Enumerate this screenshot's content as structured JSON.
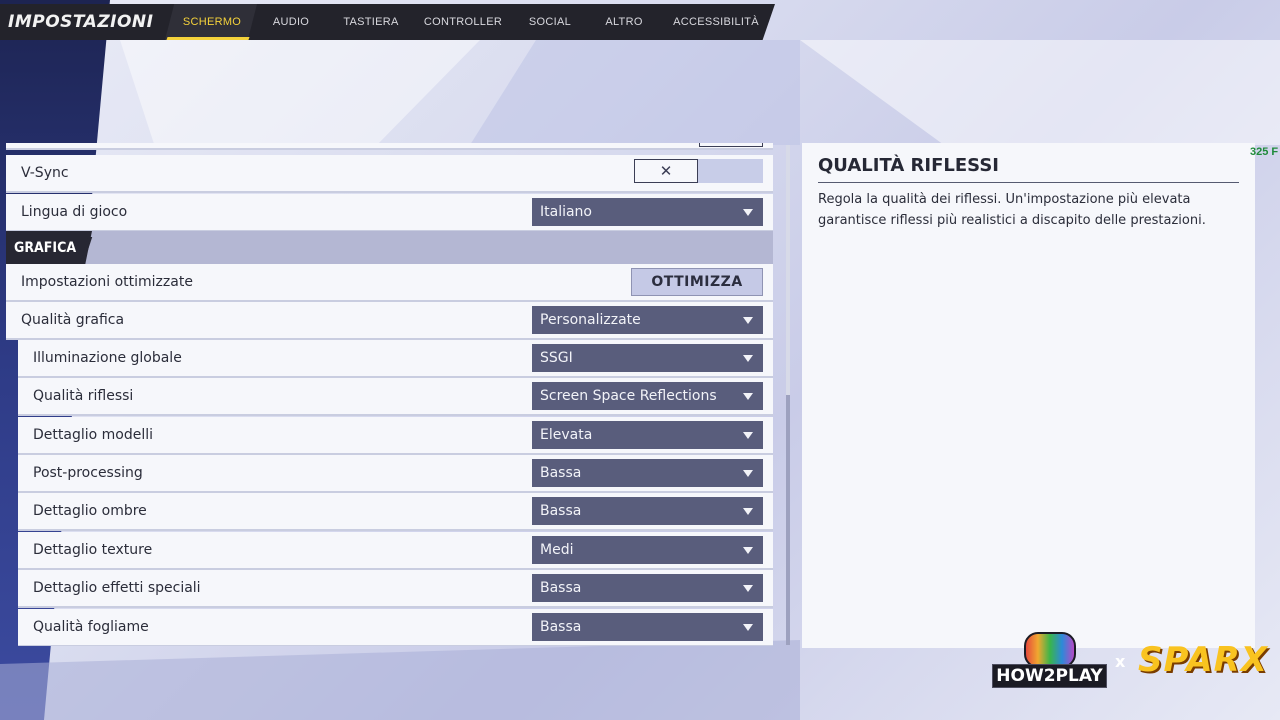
{
  "app_title": "IMPOSTAZIONI",
  "tabs": [
    {
      "label": "SCHERMO",
      "active": true
    },
    {
      "label": "AUDIO",
      "active": false
    },
    {
      "label": "TASTIERA",
      "active": false
    },
    {
      "label": "CONTROLLER",
      "active": false
    },
    {
      "label": "SOCIAL",
      "active": false
    },
    {
      "label": "ALTRO",
      "active": false
    },
    {
      "label": "ACCESSIBILITÀ",
      "active": false
    }
  ],
  "settings": {
    "vsync": {
      "label": "V-Sync",
      "icon": "close-icon",
      "value_symbol": "✕"
    },
    "language": {
      "label": "Lingua di gioco",
      "value": "Italiano"
    },
    "section_graphics": "GRAFICA",
    "optimized": {
      "label": "Impostazioni ottimizzate",
      "button": "OTTIMIZZA"
    },
    "quality": {
      "label": "Qualità grafica",
      "value": "Personalizzate"
    },
    "sub_items": [
      {
        "label": "Illuminazione globale",
        "value": "SSGI"
      },
      {
        "label": "Qualità riflessi",
        "value": "Screen Space Reflections"
      },
      {
        "label": "Dettaglio modelli",
        "value": "Elevata"
      },
      {
        "label": "Post-processing",
        "value": "Bassa"
      },
      {
        "label": "Dettaglio ombre",
        "value": "Bassa"
      },
      {
        "label": "Dettaglio texture",
        "value": "Medi"
      },
      {
        "label": "Dettaglio effetti speciali",
        "value": "Bassa"
      },
      {
        "label": "Qualità fogliame",
        "value": "Bassa"
      }
    ]
  },
  "description": {
    "title": "QUALITÀ RIFLESSI",
    "text": "Regola la qualità dei riflessi. Un'impostazione più elevata garantisce riflessi più realistici a discapito delle prestazioni."
  },
  "fps_counter": "325 F",
  "logos": {
    "how2play": "HOW2PLAY",
    "x": "x",
    "sparx": "SPARX"
  },
  "colors": {
    "accent": "#f4d23b",
    "dropdown_bg": "#595d7c",
    "nav_bg": "#23232b",
    "fps": "#1e8a3a"
  }
}
